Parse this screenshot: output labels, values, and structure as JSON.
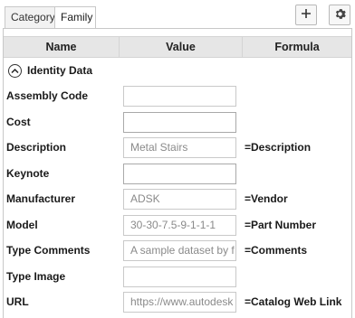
{
  "tabs": [
    {
      "label": "Category"
    },
    {
      "label": "Family"
    }
  ],
  "toolbar": {
    "add_icon": "plus-icon",
    "settings_icon": "gear-icon"
  },
  "columns": {
    "name": "Name",
    "value": "Value",
    "formula": "Formula"
  },
  "group": {
    "label": "Identity Data",
    "state_icon": "collapse-up-icon"
  },
  "rows": [
    {
      "name": "Assembly Code",
      "value": "",
      "formula": ""
    },
    {
      "name": "Cost",
      "value": "",
      "formula": ""
    },
    {
      "name": "Description",
      "value": "Metal Stairs",
      "formula": "=Description"
    },
    {
      "name": "Keynote",
      "value": "",
      "formula": ""
    },
    {
      "name": "Manufacturer",
      "value": "ADSK",
      "formula": "=Vendor"
    },
    {
      "name": "Model",
      "value": "30-30-7.5-9-1-1-1",
      "formula": "=Part Number"
    },
    {
      "name": "Type Comments",
      "value": "A sample dataset by f",
      "formula": "=Comments"
    },
    {
      "name": "Type Image",
      "value": "",
      "formula": ""
    },
    {
      "name": "URL",
      "value": "https://www.autodesk",
      "formula": "=Catalog Web Link"
    }
  ],
  "colors": {
    "header_bg": "#e6e6e6",
    "border": "#c8c8c8",
    "readonly_text": "#8a8a8a"
  }
}
